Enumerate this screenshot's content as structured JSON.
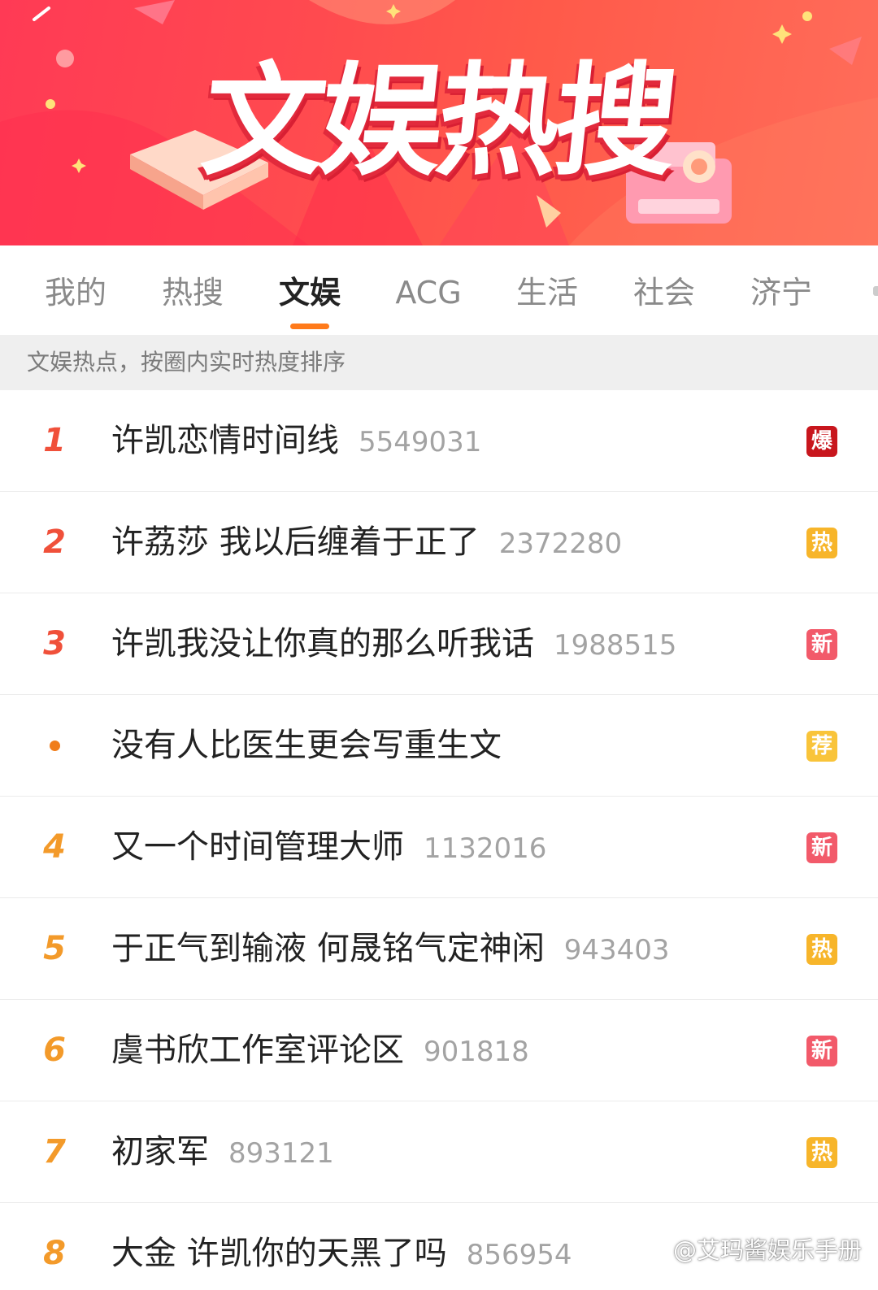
{
  "banner": {
    "title": "文娱热搜"
  },
  "tabs": [
    {
      "label": "我的"
    },
    {
      "label": "热搜"
    },
    {
      "label": "文娱",
      "active": true
    },
    {
      "label": "ACG"
    },
    {
      "label": "生活"
    },
    {
      "label": "社会"
    },
    {
      "label": "济宁"
    }
  ],
  "info": {
    "text": "文娱热点，按圈内实时热度排序"
  },
  "list": [
    {
      "rank": "1",
      "title": "许凯恋情时间线",
      "count": "5549031",
      "badge": "爆"
    },
    {
      "rank": "2",
      "title": "许荔莎 我以后缠着于正了",
      "count": "2372280",
      "badge": "热"
    },
    {
      "rank": "3",
      "title": "许凯我没让你真的那么听我话",
      "count": "1988515",
      "badge": "新"
    },
    {
      "rank": "",
      "title": "没有人比医生更会写重生文",
      "count": "",
      "badge": "荐"
    },
    {
      "rank": "4",
      "title": "又一个时间管理大师",
      "count": "1132016",
      "badge": "新"
    },
    {
      "rank": "5",
      "title": "于正气到输液 何晟铭气定神闲",
      "count": "943403",
      "badge": "热"
    },
    {
      "rank": "6",
      "title": "虞书欣工作室评论区",
      "count": "901818",
      "badge": "新"
    },
    {
      "rank": "7",
      "title": "初家军",
      "count": "893121",
      "badge": "热"
    },
    {
      "rank": "8",
      "title": "大金 许凯你的天黑了吗",
      "count": "856954",
      "badge": ""
    }
  ],
  "watermark": {
    "text": "@艾玛酱娱乐手册"
  },
  "colors": {
    "accent": "#ff7a1a",
    "rank_top": "#f0503a",
    "rank_mid": "#f39a2a",
    "badge_bao": "#c8161d",
    "badge_re": "#f7b52a",
    "badge_xin": "#f25a6a",
    "badge_jian": "#f9c43a"
  }
}
